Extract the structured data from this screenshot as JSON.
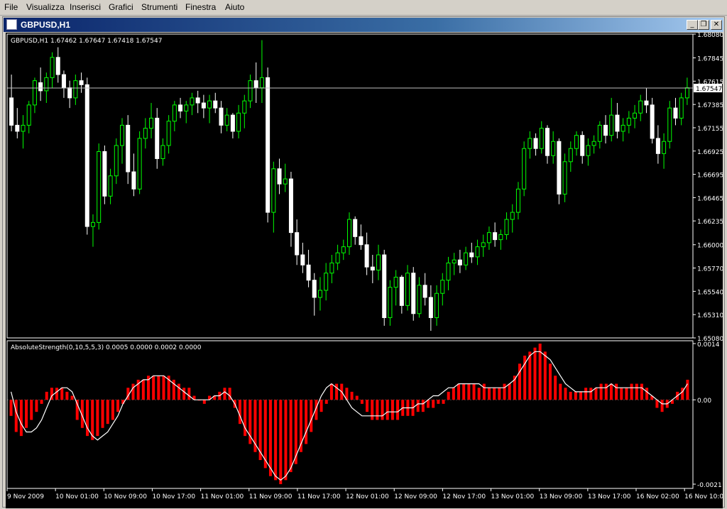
{
  "menu": [
    "File",
    "Visualizza",
    "Inserisci",
    "Grafici",
    "Strumenti",
    "Finestra",
    "Aiuto"
  ],
  "window": {
    "title": "GBPUSD,H1",
    "minimize_icon": "minimize-icon",
    "restore_icon": "restore-icon",
    "close_icon": "close-icon"
  },
  "chart_data": [
    {
      "type": "candlestick",
      "title": "GBPUSD,H1  1.67462 1.67647 1.67418 1.67547",
      "ylim": [
        1.6508,
        1.6808
      ],
      "y_ticks": [
        "1.68080",
        "1.67845",
        "1.67615",
        "1.67385",
        "1.67155",
        "1.66925",
        "1.66695",
        "1.66465",
        "1.66235",
        "1.66000",
        "1.65770",
        "1.65540",
        "1.65310",
        "1.65080"
      ],
      "current_price": "1.67547",
      "current_value": 1.67547,
      "colors": {
        "up": "#00ff00",
        "down": "#ffffff",
        "body_fill": "#000000",
        "background": "#000000",
        "axis": "#ffffff"
      },
      "candles": [
        [
          1.6745,
          1.6768,
          1.6712,
          1.6718
        ],
        [
          1.6718,
          1.6735,
          1.6705,
          1.6712
        ],
        [
          1.6712,
          1.6728,
          1.6695,
          1.6718
        ],
        [
          1.6718,
          1.6742,
          1.671,
          1.6738
        ],
        [
          1.6738,
          1.6765,
          1.673,
          1.6762
        ],
        [
          1.676,
          1.6775,
          1.6742,
          1.6752
        ],
        [
          1.6752,
          1.677,
          1.674,
          1.6765
        ],
        [
          1.6765,
          1.679,
          1.6755,
          1.6785
        ],
        [
          1.6785,
          1.6795,
          1.676,
          1.6768
        ],
        [
          1.6768,
          1.6772,
          1.6745,
          1.6755
        ],
        [
          1.6755,
          1.6762,
          1.6735,
          1.6745
        ],
        [
          1.6745,
          1.6768,
          1.6738,
          1.6762
        ],
        [
          1.6762,
          1.677,
          1.675,
          1.6758
        ],
        [
          1.6758,
          1.6765,
          1.661,
          1.6618
        ],
        [
          1.6618,
          1.663,
          1.6598,
          1.6622
        ],
        [
          1.6622,
          1.67,
          1.6615,
          1.6692
        ],
        [
          1.6692,
          1.6698,
          1.664,
          1.6648
        ],
        [
          1.6648,
          1.6675,
          1.664,
          1.6668
        ],
        [
          1.6668,
          1.6705,
          1.666,
          1.6698
        ],
        [
          1.6698,
          1.6725,
          1.668,
          1.6718
        ],
        [
          1.6718,
          1.6728,
          1.666,
          1.6672
        ],
        [
          1.6672,
          1.669,
          1.6648,
          1.6655
        ],
        [
          1.6655,
          1.6712,
          1.665,
          1.6705
        ],
        [
          1.6705,
          1.6725,
          1.6695,
          1.6715
        ],
        [
          1.6715,
          1.674,
          1.6705,
          1.6725
        ],
        [
          1.6725,
          1.6735,
          1.6675,
          1.6685
        ],
        [
          1.6685,
          1.6705,
          1.6678,
          1.6698
        ],
        [
          1.6698,
          1.6728,
          1.669,
          1.6722
        ],
        [
          1.6722,
          1.6742,
          1.6712,
          1.6738
        ],
        [
          1.6738,
          1.6745,
          1.6725,
          1.6732
        ],
        [
          1.6732,
          1.6742,
          1.672,
          1.6738
        ],
        [
          1.6738,
          1.675,
          1.6728,
          1.6745
        ],
        [
          1.6745,
          1.6752,
          1.673,
          1.674
        ],
        [
          1.674,
          1.6748,
          1.6725,
          1.6735
        ],
        [
          1.6735,
          1.6748,
          1.672,
          1.6742
        ],
        [
          1.6742,
          1.675,
          1.673,
          1.6735
        ],
        [
          1.6735,
          1.6742,
          1.671,
          1.6718
        ],
        [
          1.6718,
          1.6735,
          1.6712,
          1.6728
        ],
        [
          1.6728,
          1.673,
          1.6705,
          1.6712
        ],
        [
          1.6712,
          1.6738,
          1.6705,
          1.673
        ],
        [
          1.673,
          1.6748,
          1.6715,
          1.6742
        ],
        [
          1.6742,
          1.6768,
          1.6735,
          1.6762
        ],
        [
          1.6762,
          1.678,
          1.674,
          1.6755
        ],
        [
          1.6755,
          1.6802,
          1.674,
          1.6765
        ],
        [
          1.6765,
          1.6775,
          1.6622,
          1.6632
        ],
        [
          1.6632,
          1.6682,
          1.6612,
          1.6675
        ],
        [
          1.6675,
          1.6685,
          1.665,
          1.666
        ],
        [
          1.666,
          1.668,
          1.6652,
          1.6665
        ],
        [
          1.6665,
          1.6672,
          1.6598,
          1.6612
        ],
        [
          1.6612,
          1.6625,
          1.658,
          1.659
        ],
        [
          1.659,
          1.6602,
          1.6572,
          1.658
        ],
        [
          1.658,
          1.6595,
          1.6558,
          1.6565
        ],
        [
          1.6565,
          1.6572,
          1.653,
          1.6548
        ],
        [
          1.6548,
          1.6568,
          1.6535,
          1.6555
        ],
        [
          1.6555,
          1.6582,
          1.6545,
          1.6572
        ],
        [
          1.6572,
          1.659,
          1.6562,
          1.6582
        ],
        [
          1.6582,
          1.66,
          1.6575,
          1.6592
        ],
        [
          1.6592,
          1.6605,
          1.6585,
          1.6598
        ],
        [
          1.6598,
          1.6632,
          1.659,
          1.6625
        ],
        [
          1.6625,
          1.6628,
          1.66,
          1.6608
        ],
        [
          1.6608,
          1.662,
          1.6595,
          1.66
        ],
        [
          1.66,
          1.6612,
          1.657,
          1.6578
        ],
        [
          1.6578,
          1.659,
          1.6562,
          1.6575
        ],
        [
          1.6575,
          1.66,
          1.6565,
          1.659
        ],
        [
          1.659,
          1.6595,
          1.652,
          1.6528
        ],
        [
          1.6528,
          1.6565,
          1.652,
          1.6558
        ],
        [
          1.6558,
          1.6575,
          1.654,
          1.6568
        ],
        [
          1.6568,
          1.657,
          1.6532,
          1.654
        ],
        [
          1.654,
          1.658,
          1.6535,
          1.6572
        ],
        [
          1.6572,
          1.6578,
          1.6525,
          1.6532
        ],
        [
          1.6532,
          1.6568,
          1.6528,
          1.656
        ],
        [
          1.656,
          1.6572,
          1.654,
          1.6548
        ],
        [
          1.6548,
          1.656,
          1.6515,
          1.6528
        ],
        [
          1.6528,
          1.656,
          1.652,
          1.6552
        ],
        [
          1.6552,
          1.6572,
          1.654,
          1.6565
        ],
        [
          1.6565,
          1.6588,
          1.6555,
          1.6582
        ],
        [
          1.6582,
          1.6592,
          1.657,
          1.6585
        ],
        [
          1.6585,
          1.6595,
          1.6572,
          1.658
        ],
        [
          1.658,
          1.6598,
          1.6575,
          1.6592
        ],
        [
          1.6592,
          1.6602,
          1.6582,
          1.6588
        ],
        [
          1.6588,
          1.6605,
          1.658,
          1.6598
        ],
        [
          1.6598,
          1.661,
          1.6588,
          1.6602
        ],
        [
          1.6602,
          1.6618,
          1.6595,
          1.6612
        ],
        [
          1.6612,
          1.6622,
          1.6598,
          1.6605
        ],
        [
          1.6605,
          1.6615,
          1.6595,
          1.661
        ],
        [
          1.661,
          1.6632,
          1.6605,
          1.6625
        ],
        [
          1.6625,
          1.664,
          1.6612,
          1.6632
        ],
        [
          1.6632,
          1.6662,
          1.6625,
          1.6655
        ],
        [
          1.6655,
          1.6702,
          1.6648,
          1.6695
        ],
        [
          1.6695,
          1.6712,
          1.6685,
          1.6705
        ],
        [
          1.6705,
          1.671,
          1.6688,
          1.6695
        ],
        [
          1.6695,
          1.6722,
          1.669,
          1.6715
        ],
        [
          1.6715,
          1.6718,
          1.668,
          1.6688
        ],
        [
          1.6688,
          1.6712,
          1.668,
          1.6702
        ],
        [
          1.6702,
          1.6705,
          1.664,
          1.665
        ],
        [
          1.665,
          1.669,
          1.6642,
          1.6682
        ],
        [
          1.6682,
          1.6702,
          1.6672,
          1.6695
        ],
        [
          1.6695,
          1.6712,
          1.6688,
          1.6708
        ],
        [
          1.6708,
          1.6712,
          1.668,
          1.6688
        ],
        [
          1.6688,
          1.6705,
          1.6678,
          1.6698
        ],
        [
          1.6698,
          1.6708,
          1.669,
          1.6702
        ],
        [
          1.6702,
          1.6722,
          1.6695,
          1.6718
        ],
        [
          1.6718,
          1.6728,
          1.67,
          1.6708
        ],
        [
          1.6708,
          1.6745,
          1.6702,
          1.6728
        ],
        [
          1.6728,
          1.674,
          1.6705,
          1.6712
        ],
        [
          1.6712,
          1.6725,
          1.6702,
          1.6718
        ],
        [
          1.6718,
          1.6732,
          1.671,
          1.6725
        ],
        [
          1.6725,
          1.6738,
          1.6715,
          1.673
        ],
        [
          1.673,
          1.6748,
          1.6722,
          1.6742
        ],
        [
          1.6742,
          1.6755,
          1.673,
          1.6738
        ],
        [
          1.6738,
          1.6745,
          1.67,
          1.6705
        ],
        [
          1.6705,
          1.6718,
          1.668,
          1.669
        ],
        [
          1.669,
          1.671,
          1.6675,
          1.6702
        ],
        [
          1.6702,
          1.6742,
          1.6695,
          1.6735
        ],
        [
          1.6735,
          1.6745,
          1.6718,
          1.6725
        ],
        [
          1.6725,
          1.675,
          1.6718,
          1.6745
        ],
        [
          1.6745,
          1.6765,
          1.6738,
          1.6755
        ]
      ]
    },
    {
      "type": "bar",
      "title": "AbsoluteStrength(0,10,5,5,3) 0.0005 0.0000 0.0002 0.0000",
      "ylim": [
        -0.0021,
        0.0014
      ],
      "y_ticks": [
        "0.0014",
        "0.00",
        "-0.0021"
      ],
      "colors": {
        "bars": "#ff0000",
        "line": "#ffffff"
      },
      "values": [
        -0.0004,
        -0.0008,
        -0.0009,
        -0.0007,
        -0.0005,
        -0.0003,
        -0.0001,
        0.0002,
        0.0003,
        0.0003,
        0.0003,
        0.0002,
        0.0001,
        -0.0005,
        -0.0007,
        -0.0009,
        -0.001,
        -0.0009,
        -0.0007,
        -0.0006,
        -0.0005,
        -0.0003,
        -0.0001,
        0.0003,
        0.0004,
        0.0005,
        0.0005,
        0.0006,
        0.0006,
        0.0006,
        0.0006,
        0.0006,
        0.0005,
        0.0004,
        0.0003,
        0.0003,
        0.0001,
        0.0,
        -0.0001,
        0.0001,
        0.0001,
        0.0002,
        0.0003,
        0.0003,
        -0.0002,
        -0.0006,
        -0.0009,
        -0.0011,
        -0.0013,
        -0.0015,
        -0.0017,
        -0.0019,
        -0.002,
        -0.0021,
        -0.002,
        -0.0018,
        -0.0016,
        -0.0013,
        -0.0011,
        -0.0008,
        -0.0005,
        -0.0003,
        -0.0001,
        0.0004,
        0.0004,
        0.0004,
        0.0003,
        0.0002,
        0.0001,
        -0.0001,
        -0.0003,
        -0.0005,
        -0.0005,
        -0.0005,
        -0.0005,
        -0.0005,
        -0.0005,
        -0.0004,
        -0.0004,
        -0.0004,
        -0.0003,
        -0.0003,
        -0.0002,
        -0.0002,
        -0.0001,
        -0.0001,
        0.0002,
        0.0003,
        0.0004,
        0.0004,
        0.0004,
        0.0004,
        0.0003,
        0.0004,
        0.0003,
        0.0003,
        0.0003,
        0.0004,
        0.0004,
        0.0006,
        0.0009,
        0.0011,
        0.0012,
        0.0013,
        0.0014,
        0.0012,
        0.0009,
        0.0006,
        0.0004,
        0.0003,
        0.0002,
        0.0002,
        0.0002,
        0.0003,
        0.0003,
        0.0003,
        0.0004,
        0.0004,
        0.0004,
        0.0004,
        0.0003,
        0.0003,
        0.0004,
        0.0004,
        0.0004,
        0.0003,
        0.0001,
        -0.0002,
        -0.0003,
        -0.0002,
        -0.0001,
        0.0002,
        0.0003,
        0.0005
      ],
      "line_values": [
        0.0002,
        -0.0003,
        -0.0006,
        -0.0008,
        -0.0008,
        -0.0007,
        -0.0005,
        -0.0002,
        0.0001,
        0.0002,
        0.0003,
        0.0003,
        0.0002,
        -0.0001,
        -0.0004,
        -0.0007,
        -0.0009,
        -0.001,
        -0.0009,
        -0.0008,
        -0.0006,
        -0.0004,
        -0.0001,
        0.0001,
        0.0003,
        0.0004,
        0.0005,
        0.0005,
        0.0006,
        0.0006,
        0.0006,
        0.0005,
        0.0004,
        0.0003,
        0.0002,
        0.0001,
        0.0,
        0.0,
        0.0,
        0.0,
        0.0001,
        0.0001,
        0.0002,
        0.0001,
        -0.0001,
        -0.0004,
        -0.0007,
        -0.0009,
        -0.0011,
        -0.0013,
        -0.0015,
        -0.0017,
        -0.0019,
        -0.002,
        -0.0019,
        -0.0017,
        -0.0014,
        -0.0011,
        -0.0008,
        -0.0005,
        -0.0002,
        0.0001,
        0.0003,
        0.0004,
        0.0003,
        0.0002,
        0.0,
        -0.0002,
        -0.0003,
        -0.0004,
        -0.0004,
        -0.0004,
        -0.0004,
        -0.0004,
        -0.0003,
        -0.0003,
        -0.0003,
        -0.0002,
        -0.0002,
        -0.0002,
        -0.0001,
        -0.0001,
        0.0,
        0.0001,
        0.0001,
        0.0002,
        0.0003,
        0.0003,
        0.0004,
        0.0004,
        0.0004,
        0.0004,
        0.0004,
        0.0003,
        0.0003,
        0.0003,
        0.0003,
        0.0003,
        0.0004,
        0.0005,
        0.0007,
        0.0009,
        0.0011,
        0.0012,
        0.0012,
        0.0011,
        0.001,
        0.0008,
        0.0006,
        0.0004,
        0.0003,
        0.0002,
        0.0002,
        0.0002,
        0.0002,
        0.0003,
        0.0003,
        0.0003,
        0.0004,
        0.0003,
        0.0003,
        0.0003,
        0.0003,
        0.0003,
        0.0003,
        0.0002,
        0.0001,
        0.0,
        -0.0001,
        -0.0001,
        0.0,
        0.0001,
        0.0002,
        0.0004
      ]
    }
  ],
  "x_axis_labels": [
    "9 Nov 2009",
    "10 Nov 01:00",
    "10 Nov 09:00",
    "10 Nov 17:00",
    "11 Nov 01:00",
    "11 Nov 09:00",
    "11 Nov 17:00",
    "12 Nov 01:00",
    "12 Nov 09:00",
    "12 Nov 17:00",
    "13 Nov 01:00",
    "13 Nov 09:00",
    "13 Nov 17:00",
    "16 Nov 02:00",
    "16 Nov 10:00"
  ]
}
